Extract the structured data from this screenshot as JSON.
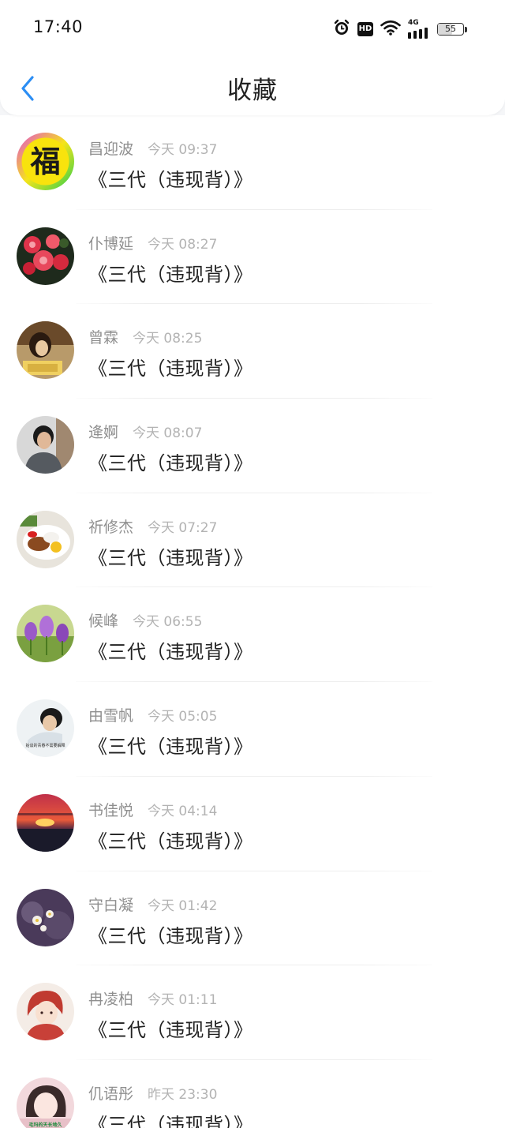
{
  "status_bar": {
    "time": "17:40",
    "hd_label": "HD",
    "network_label": "4G",
    "battery_level": "55",
    "battery_fraction": 0.55,
    "icons": [
      "alarm-icon",
      "hd-icon",
      "wifi-icon",
      "cellular-signal-icon",
      "battery-icon"
    ]
  },
  "header": {
    "title": "收藏",
    "back_icon": "chevron-left-icon",
    "accent_color": "#2c8ef4"
  },
  "favorites": [
    {
      "name": "昌迎波",
      "time": "今天 09:37",
      "title": "《三代（违现背）》",
      "avatar_text": "福"
    },
    {
      "name": "仆博延",
      "time": "今天 08:27",
      "title": "《三代（违现背）》"
    },
    {
      "name": "曾霖",
      "time": "今天 08:25",
      "title": "《三代（违现背）》"
    },
    {
      "name": "逄婀",
      "time": "今天 08:07",
      "title": "《三代（违现背）》"
    },
    {
      "name": "祈修杰",
      "time": "今天 07:27",
      "title": "《三代（违现背）》"
    },
    {
      "name": "候峰",
      "time": "今天 06:55",
      "title": "《三代（违现背）》"
    },
    {
      "name": "由雪帆",
      "time": "今天 05:05",
      "title": "《三代（违现背）》",
      "avatar_text": "始谈的青春不需要解释"
    },
    {
      "name": "书佳悦",
      "time": "今天 04:14",
      "title": "《三代（违现背）》"
    },
    {
      "name": "守白凝",
      "time": "今天 01:42",
      "title": "《三代（违现背）》"
    },
    {
      "name": "冉凌柏",
      "time": "今天 01:11",
      "title": "《三代（违现背）》"
    },
    {
      "name": "仉语彤",
      "time": "昨天 23:30",
      "title": "《三代（违现背）》",
      "avatar_text": "毛玛的天长地久"
    }
  ]
}
